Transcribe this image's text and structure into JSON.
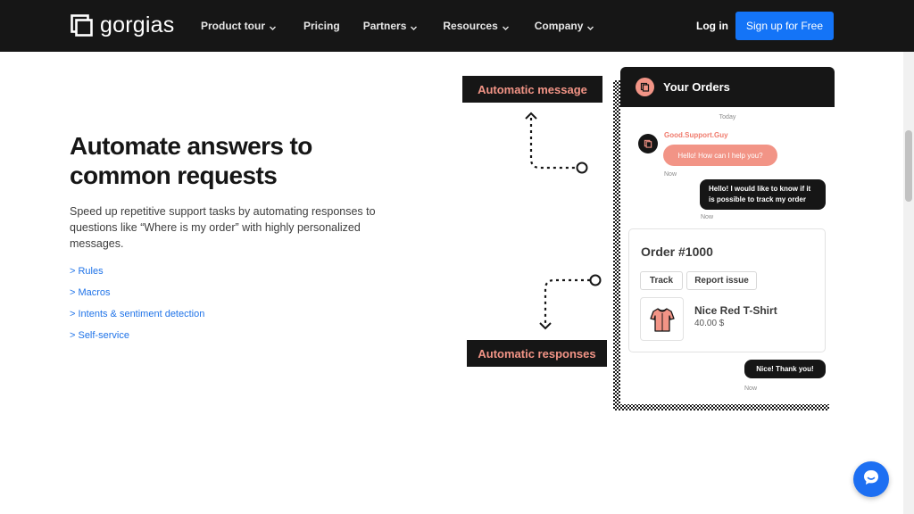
{
  "header": {
    "logo_text": "gorgias",
    "nav": [
      {
        "label": "Product tour",
        "has_dropdown": true
      },
      {
        "label": "Pricing",
        "has_dropdown": false
      },
      {
        "label": "Partners",
        "has_dropdown": true
      },
      {
        "label": "Resources",
        "has_dropdown": true
      },
      {
        "label": "Company",
        "has_dropdown": true
      }
    ],
    "login_label": "Log in",
    "signup_label": "Sign up for Free"
  },
  "hero": {
    "headline": "Automate answers to common requests",
    "description": "Speed up repetitive support tasks by automating responses to questions like “Where is my order” with highly personalized messages.",
    "links": [
      "> Rules",
      "> Macros",
      "> Intents & sentiment detection",
      "> Self-service"
    ]
  },
  "illustration": {
    "tag_top": "Automatic message",
    "tag_bottom": "Automatic responses",
    "chat": {
      "title": "Your Orders",
      "day_label": "Today",
      "agent_name": "Good.Support.Guy",
      "agent_message": "Hello! How can I help you?",
      "time_1": "Now",
      "customer_message": "Hello! I would like to know if it is possible to track my order",
      "time_2": "Now",
      "order": {
        "title": "Order #1000",
        "track_label": "Track",
        "report_label": "Report issue",
        "product_name": "Nice Red T-Shirt",
        "product_price": "40.00 $"
      },
      "thanks_message": "Nice! Thank you!",
      "time_3": "Now"
    }
  },
  "colors": {
    "nav_bg": "#161616",
    "accent_blue": "#1474f7",
    "accent_salmon": "#f29486",
    "link_blue": "#1f73e8"
  },
  "icons": [
    "gorgias-logo-icon",
    "chevron-down-icon",
    "order-icon",
    "shirt-icon",
    "chat-launcher-icon"
  ]
}
